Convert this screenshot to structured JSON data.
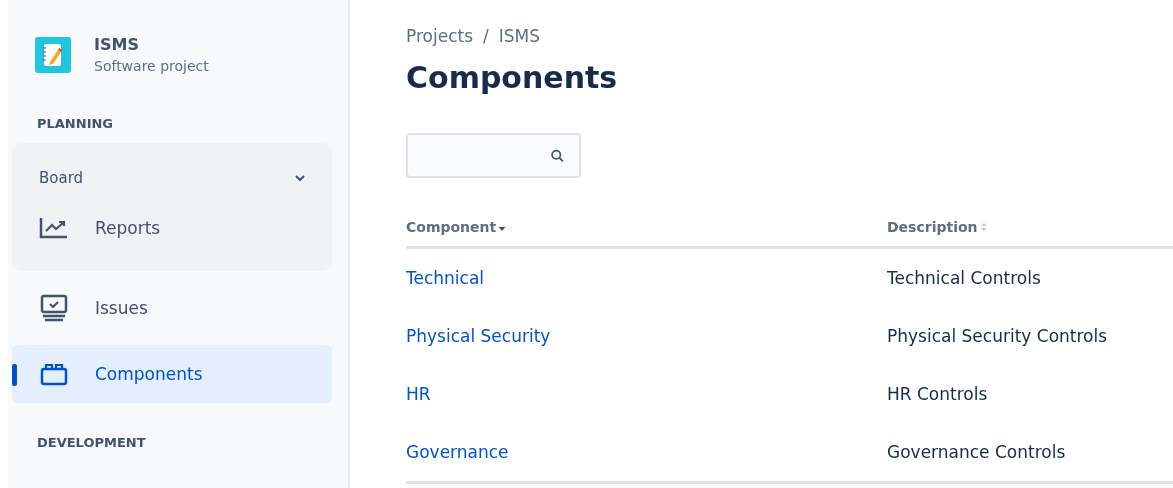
{
  "project": {
    "name": "ISMS",
    "type": "Software project"
  },
  "sections": [
    {
      "title": "PLANNING"
    },
    {
      "title": "DEVELOPMENT"
    }
  ],
  "board": {
    "label": "Board",
    "expanded": true,
    "items": [
      {
        "label": "Reports",
        "selected": false
      }
    ]
  },
  "nav": [
    {
      "label": "Issues",
      "selected": false
    },
    {
      "label": "Components",
      "selected": true
    }
  ],
  "breadcrumbs": [
    "Projects",
    "ISMS"
  ],
  "breadcrumb_separator": "/",
  "page_title": "Components",
  "table": {
    "columns": [
      {
        "label": "Component",
        "sorted": true
      },
      {
        "label": "Description",
        "sorted": false
      }
    ],
    "rows": [
      {
        "name": "Technical",
        "description": "Technical Controls"
      },
      {
        "name": "Physical Security",
        "description": "Physical Security Controls"
      },
      {
        "name": "HR",
        "description": "HR Controls"
      },
      {
        "name": "Governance",
        "description": "Governance Controls"
      }
    ]
  }
}
